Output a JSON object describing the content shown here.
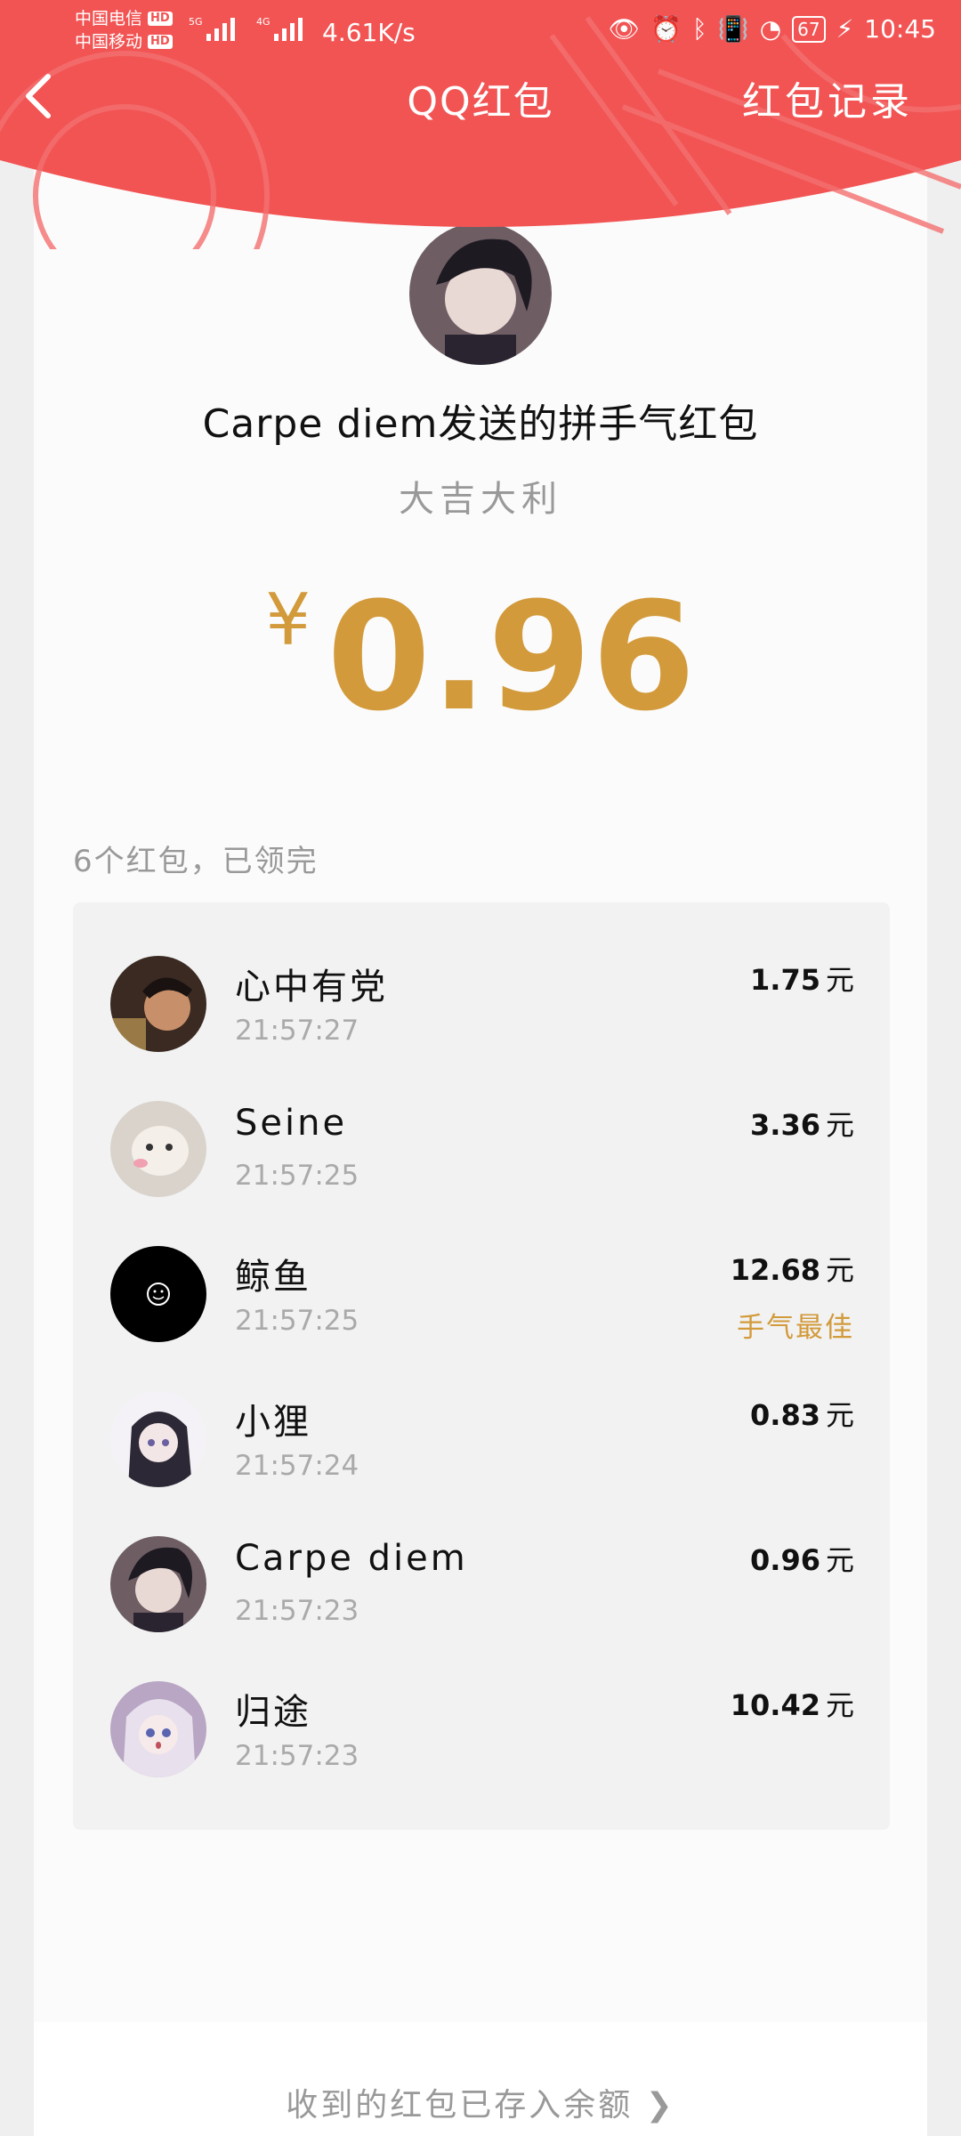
{
  "status_bar": {
    "carrier_1": "中国电信",
    "carrier_2": "中国移动",
    "hd_badge": "HD",
    "net_5g": "5G",
    "net_4g": "4G",
    "net_speed": "4.61K/s",
    "battery": "67",
    "time": "10:45"
  },
  "nav": {
    "title": "QQ红包",
    "records_link": "红包记录"
  },
  "packet": {
    "sender_title": "Carpe  diem发送的拼手气红包",
    "blessing": "大吉大利",
    "currency_symbol": "¥",
    "amount": "0.96"
  },
  "summary": "6个红包，已领完",
  "recipients": [
    {
      "name": "心中有党",
      "time": "21:57:27",
      "amount": "1.75",
      "unit": "元",
      "badge": ""
    },
    {
      "name": "Seine",
      "time": "21:57:25",
      "amount": "3.36",
      "unit": "元",
      "badge": ""
    },
    {
      "name": "鲸鱼",
      "time": "21:57:25",
      "amount": "12.68",
      "unit": "元",
      "badge": "手气最佳"
    },
    {
      "name": "小狸",
      "time": "21:57:24",
      "amount": "0.83",
      "unit": "元",
      "badge": ""
    },
    {
      "name": "Carpe  diem",
      "time": "21:57:23",
      "amount": "0.96",
      "unit": "元",
      "badge": ""
    },
    {
      "name": "归途",
      "time": "21:57:23",
      "amount": "10.42",
      "unit": "元",
      "badge": ""
    }
  ],
  "footer_note": "收到的红包已存入余额 ❯",
  "colors": {
    "header_red": "#f25454",
    "gold": "#d29a3a",
    "muted": "#999999"
  }
}
